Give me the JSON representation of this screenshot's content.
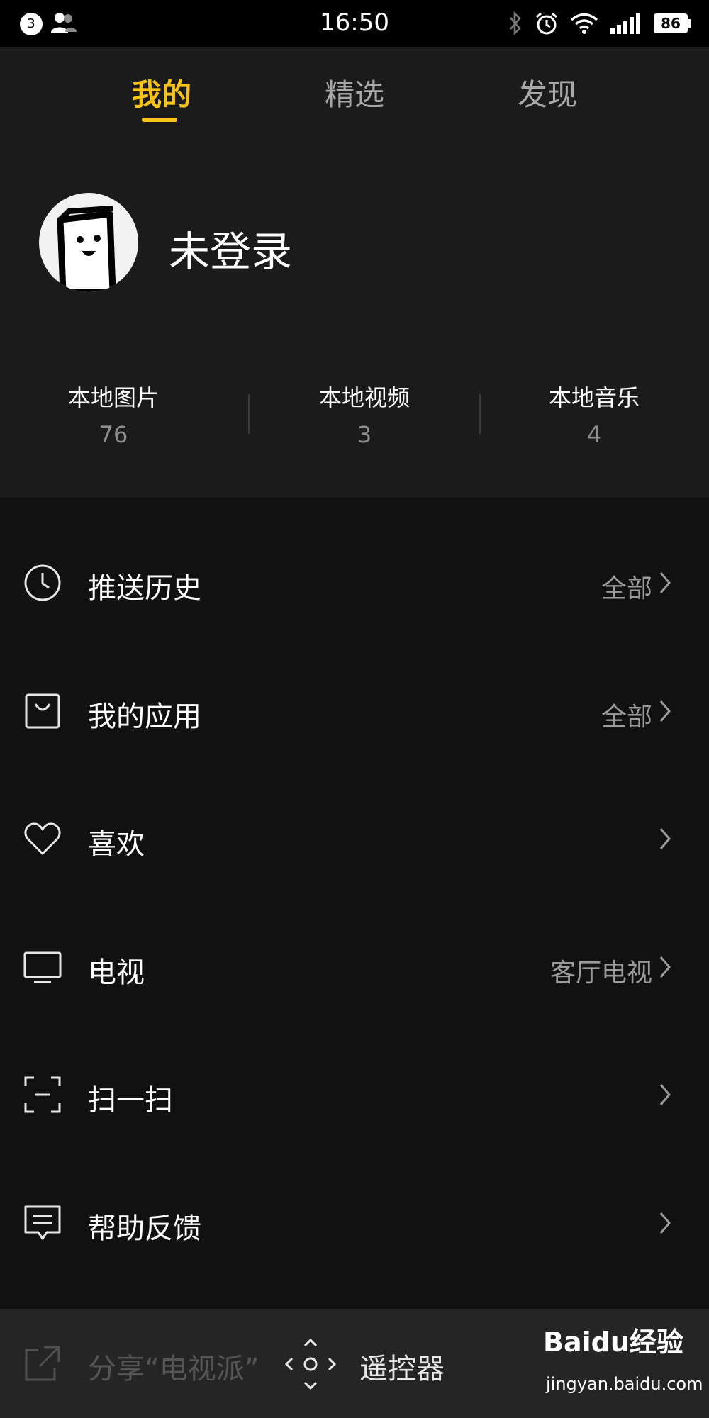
{
  "status_bar": {
    "notification_count": "3",
    "time": "16:50",
    "battery": "86",
    "icons": [
      "people-icon",
      "bluetooth-icon",
      "alarm-icon",
      "wifi-icon",
      "signal-icon",
      "battery-icon"
    ]
  },
  "tabs": [
    {
      "label": "我的",
      "active": true
    },
    {
      "label": "精选",
      "active": false
    },
    {
      "label": "发现",
      "active": false
    }
  ],
  "profile": {
    "name": "未登录",
    "avatar_icon": "mascot-avatar-icon"
  },
  "stats": [
    {
      "label": "本地图片",
      "value": "76"
    },
    {
      "label": "本地视频",
      "value": "3"
    },
    {
      "label": "本地音乐",
      "value": "4"
    }
  ],
  "menu": [
    {
      "icon": "clock-icon",
      "label": "推送历史",
      "value": "全部"
    },
    {
      "icon": "bag-icon",
      "label": "我的应用",
      "value": "全部"
    },
    {
      "icon": "heart-icon",
      "label": "喜欢",
      "value": ""
    },
    {
      "icon": "tv-icon",
      "label": "电视",
      "value": "客厅电视"
    },
    {
      "icon": "scan-icon",
      "label": "扫一扫",
      "value": ""
    },
    {
      "icon": "feedback-icon",
      "label": "帮助反馈",
      "value": ""
    }
  ],
  "bottom_bar": {
    "obscured_item_label": "分享“电视派”",
    "remote_label": "遥控器",
    "remote_icon": "dpad-remote-icon"
  },
  "watermark": {
    "logo": "Baidu经验",
    "url": "jingyan.baidu.com"
  },
  "colors": {
    "accent": "#f6c318",
    "background": "#111111",
    "header_background": "#1b1b1b",
    "bottom_bar": "#252525"
  }
}
